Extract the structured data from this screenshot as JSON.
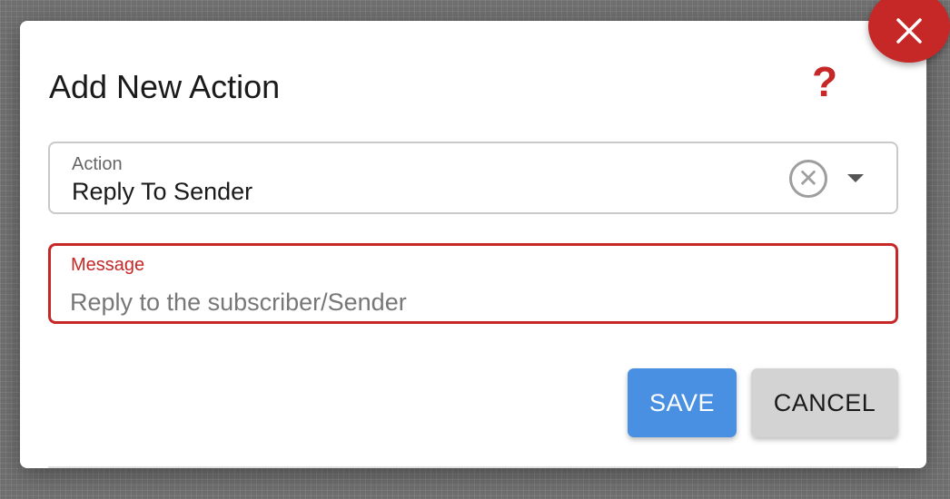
{
  "dialog": {
    "title": "Add New Action",
    "help_icon": "question-mark-icon",
    "help_symbol": "?",
    "close_icon": "close-icon",
    "accent_color": "#c62828"
  },
  "action_field": {
    "label": "Action",
    "value": "Reply To Sender",
    "clear_icon": "clear-circle-icon",
    "clear_symbol": "✕",
    "dropdown_icon": "caret-down-icon"
  },
  "message_field": {
    "label": "Message",
    "value": "",
    "placeholder": "Reply to the subscriber/Sender",
    "error_color": "#c62828"
  },
  "buttons": {
    "save_label": "SAVE",
    "cancel_label": "CANCEL",
    "save_color": "#4a90e2",
    "cancel_color": "#d3d3d3"
  }
}
